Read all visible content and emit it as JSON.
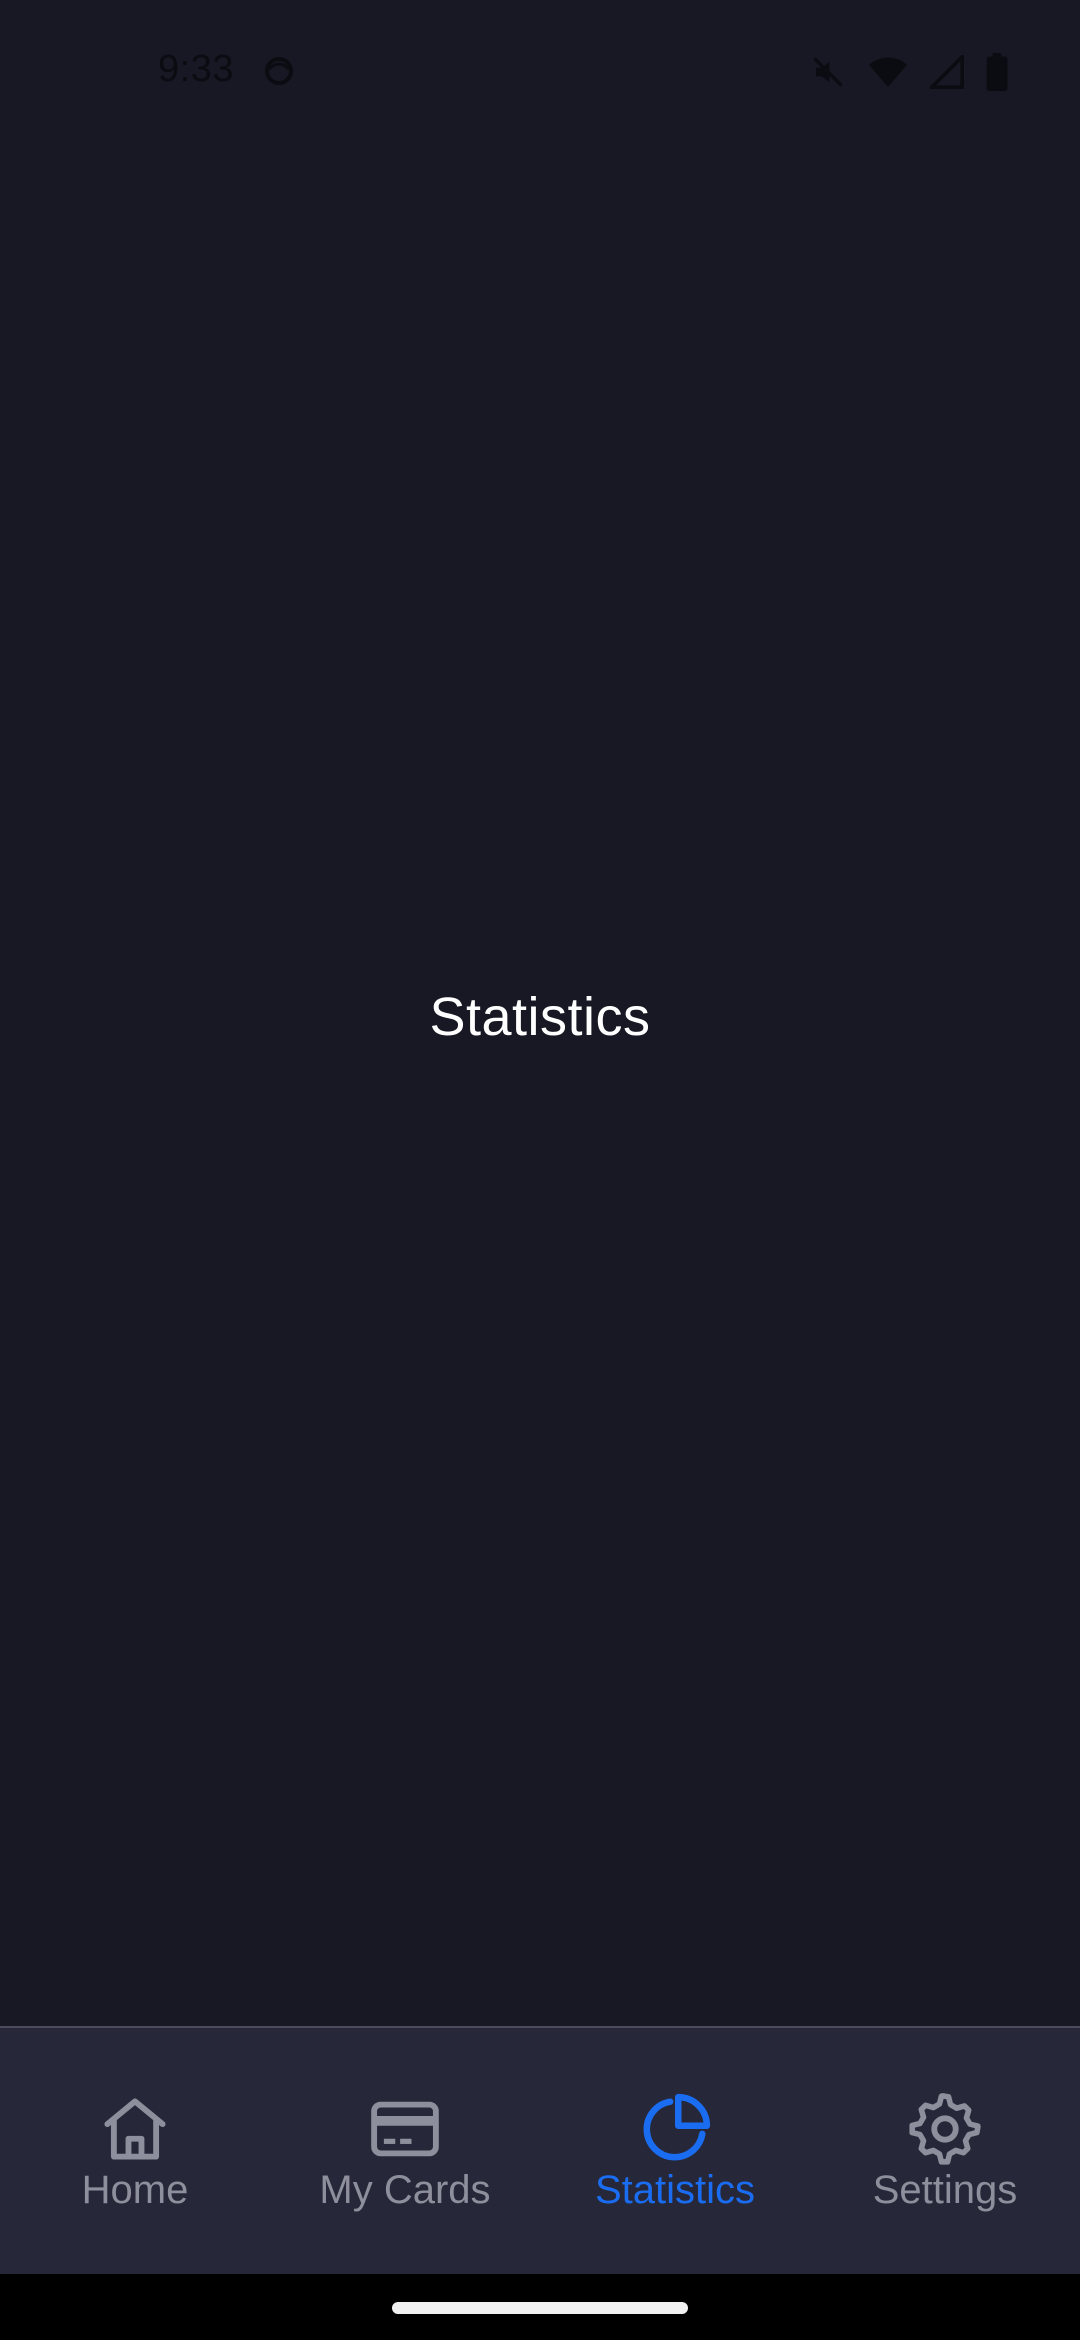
{
  "status_bar": {
    "time": "9:33",
    "icons": [
      "app-ring-icon",
      "mute-icon",
      "wifi-icon",
      "cell-signal-icon",
      "battery-icon"
    ]
  },
  "main": {
    "title": "Statistics"
  },
  "bottom_nav": {
    "items": [
      {
        "label": "Home",
        "icon": "home-icon",
        "active": false
      },
      {
        "label": "My Cards",
        "icon": "card-icon",
        "active": false
      },
      {
        "label": "Statistics",
        "icon": "pie-chart-icon",
        "active": true
      },
      {
        "label": "Settings",
        "icon": "gear-icon",
        "active": false
      }
    ]
  },
  "colors": {
    "background": "#181824",
    "nav_background": "#262739",
    "accent": "#1a6cf0",
    "inactive": "#8e8f9c",
    "title_text": "#ffffff"
  }
}
